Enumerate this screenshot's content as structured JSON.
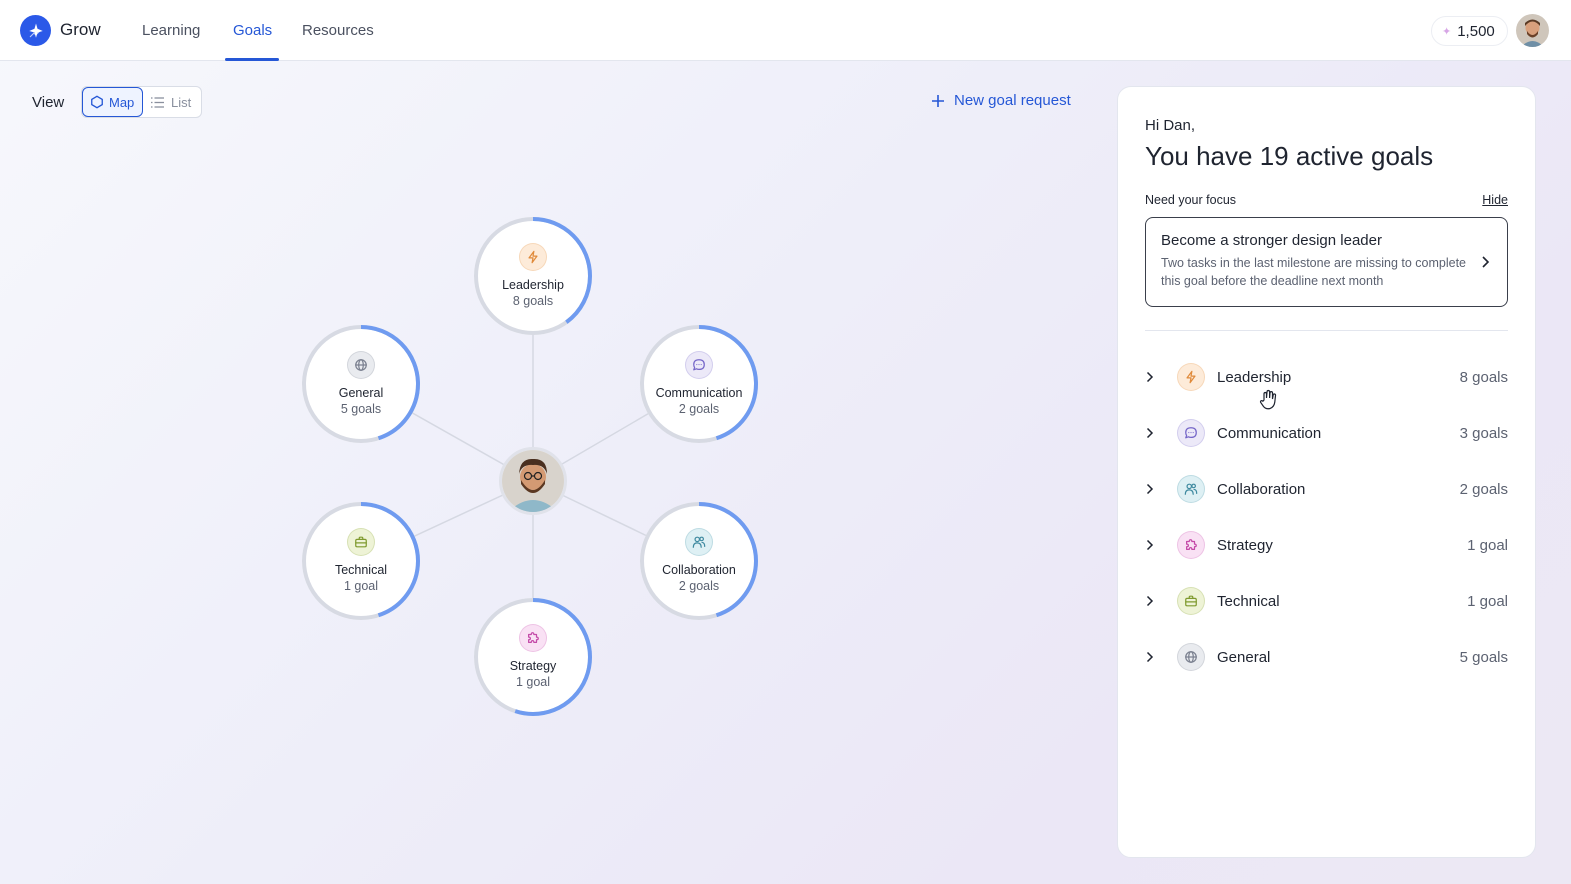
{
  "app": {
    "brand": "Grow"
  },
  "nav": {
    "items": [
      "Learning",
      "Goals",
      "Resources"
    ],
    "active": "Goals"
  },
  "header": {
    "points": "1,500"
  },
  "view": {
    "label": "View",
    "map_label": "Map",
    "list_label": "List",
    "selected": "Map"
  },
  "new_goal_label": "New goal request",
  "map_nodes": [
    {
      "key": "leadership",
      "name": "Leadership",
      "count": "8 goals",
      "icon": "lightning-icon",
      "progress": 0.4
    },
    {
      "key": "communication",
      "name": "Communication",
      "count": "2 goals",
      "icon": "chat-bubble-icon",
      "progress": 0.45
    },
    {
      "key": "collaboration",
      "name": "Collaboration",
      "count": "2 goals",
      "icon": "people-icon",
      "progress": 0.45
    },
    {
      "key": "strategy",
      "name": "Strategy",
      "count": "1 goal",
      "icon": "puzzle-icon",
      "progress": 0.55
    },
    {
      "key": "technical",
      "name": "Technical",
      "count": "1 goal",
      "icon": "briefcase-icon",
      "progress": 0.45
    },
    {
      "key": "general",
      "name": "General",
      "count": "5 goals",
      "icon": "globe-icon",
      "progress": 0.45
    }
  ],
  "panel": {
    "greeting": "Hi Dan,",
    "headline": "You have 19 active goals",
    "focus_label": "Need your focus",
    "hide_label": "Hide",
    "focus_card": {
      "title": "Become a stronger design leader",
      "description": "Two tasks in the last milestone are missing to complete this goal before the deadline next month"
    },
    "categories": [
      {
        "name": "Leadership",
        "count": "8 goals",
        "icon": "lightning-icon"
      },
      {
        "name": "Communication",
        "count": "3 goals",
        "icon": "chat-bubble-icon"
      },
      {
        "name": "Collaboration",
        "count": "2 goals",
        "icon": "people-icon"
      },
      {
        "name": "Strategy",
        "count": "1 goal",
        "icon": "puzzle-icon"
      },
      {
        "name": "Technical",
        "count": "1 goal",
        "icon": "briefcase-icon"
      },
      {
        "name": "General",
        "count": "5 goals",
        "icon": "globe-icon"
      }
    ]
  },
  "colors": {
    "accent": "#2557d6",
    "ring_progress": "#6f9bf0",
    "ring_track": "#d7dae3",
    "leadership_bg": "#fdebd9",
    "leadership_fg": "#e08a3a",
    "communication_bg": "#ece9f8",
    "communication_fg": "#7566c8",
    "collaboration_bg": "#def0f4",
    "collaboration_fg": "#3f8aa0",
    "strategy_bg": "#f9e1f4",
    "strategy_fg": "#c44aa8",
    "technical_bg": "#eef3d6",
    "technical_fg": "#7f9a2e",
    "general_bg": "#e9ebef",
    "general_fg": "#7b8190"
  }
}
